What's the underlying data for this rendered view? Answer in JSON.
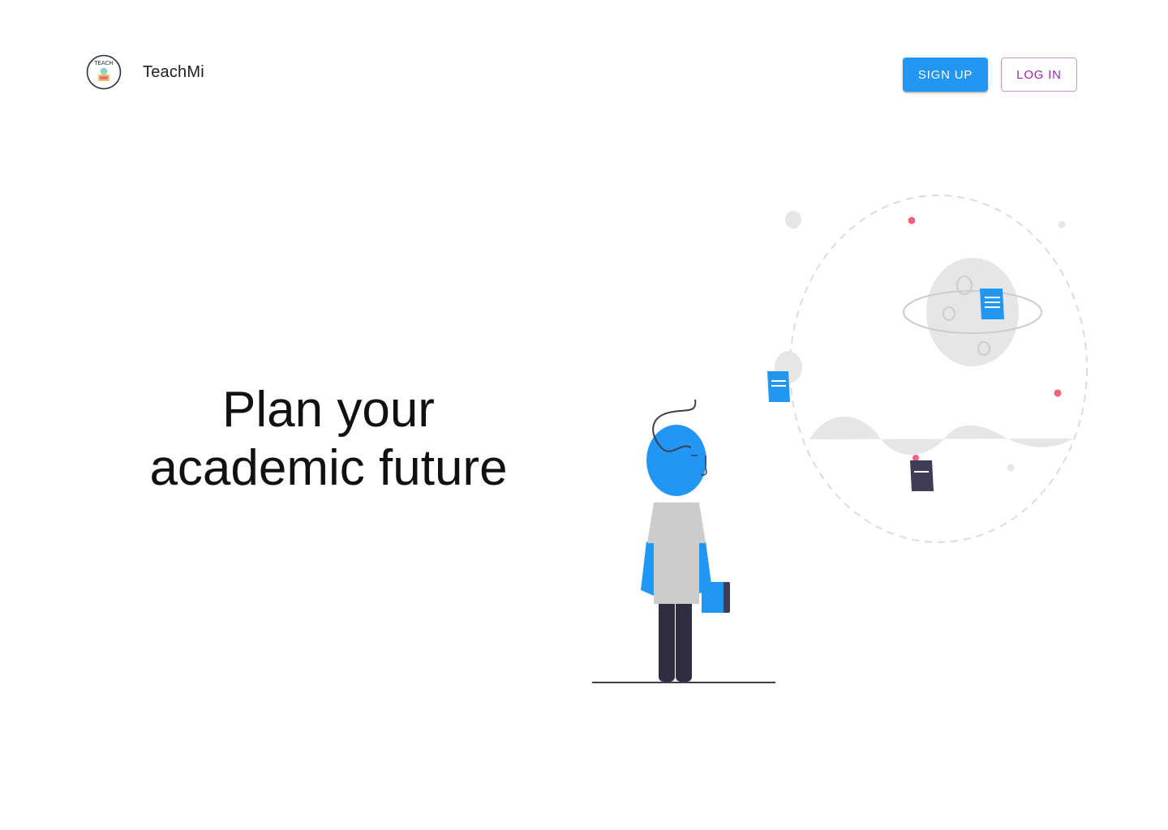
{
  "header": {
    "brand_name": "TeachMi",
    "logo_text": "TEACH",
    "logo_icon": "teach-badge-icon",
    "signup_label": "SIGN UP",
    "login_label": "LOG IN"
  },
  "hero": {
    "line1": "Plan your",
    "line2": "academic future"
  },
  "illustration": {
    "icon": "person-looking-at-planet-illustration"
  },
  "colors": {
    "primary": "#2196f3",
    "secondary": "#9c27b0",
    "secondary_border": "#ce93d8",
    "dark": "#3f3d56",
    "grey": "#e6e6e6",
    "pink": "#f06380"
  }
}
